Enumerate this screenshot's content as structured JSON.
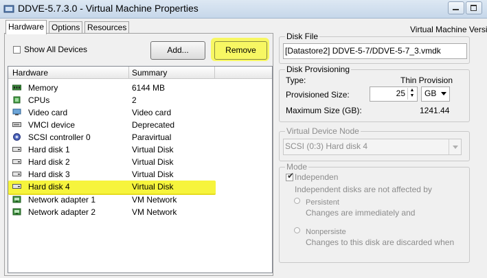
{
  "window": {
    "title": "DDVE-5.7.3.0 - Virtual Machine Properties",
    "right_header": "Virtual Machine Versi"
  },
  "tabs": [
    {
      "label": "Hardware",
      "active": true
    },
    {
      "label": "Options",
      "active": false
    },
    {
      "label": "Resources",
      "active": false
    }
  ],
  "toolbar": {
    "show_all_devices_label": "Show All Devices",
    "show_all_devices_checked": false,
    "add_label": "Add...",
    "remove_label": "Remove"
  },
  "hardware_table": {
    "columns": [
      "Hardware",
      "Summary"
    ],
    "rows": [
      {
        "name": "Memory",
        "summary": "6144 MB",
        "icon": "memory-icon"
      },
      {
        "name": "CPUs",
        "summary": "2",
        "icon": "cpu-icon"
      },
      {
        "name": "Video card",
        "summary": "Video card",
        "icon": "video-card-icon"
      },
      {
        "name": "VMCI device",
        "summary": "Deprecated",
        "icon": "vmci-device-icon"
      },
      {
        "name": "SCSI controller 0",
        "summary": "Paravirtual",
        "icon": "scsi-controller-icon"
      },
      {
        "name": "Hard disk 1",
        "summary": "Virtual Disk",
        "icon": "hard-disk-icon"
      },
      {
        "name": "Hard disk 2",
        "summary": "Virtual Disk",
        "icon": "hard-disk-icon"
      },
      {
        "name": "Hard disk 3",
        "summary": "Virtual Disk",
        "icon": "hard-disk-icon"
      },
      {
        "name": "Hard disk 4",
        "summary": "Virtual Disk",
        "icon": "hard-disk-icon",
        "selected": true
      },
      {
        "name": "Network adapter 1",
        "summary": "VM Network",
        "icon": "network-adapter-icon"
      },
      {
        "name": "Network adapter 2",
        "summary": "VM Network",
        "icon": "network-adapter-icon"
      }
    ]
  },
  "disk_file": {
    "group_label": "Disk File",
    "value": "[Datastore2] DDVE-5-7/DDVE-5-7_3.vmdk"
  },
  "disk_provisioning": {
    "group_label": "Disk Provisioning",
    "type_label": "Type:",
    "type_value": "Thin Provision",
    "provisioned_size_label": "Provisioned Size:",
    "provisioned_size_value": "25",
    "unit": "GB",
    "max_size_label": "Maximum Size (GB):",
    "max_size_value": "1241.44"
  },
  "virtual_device_node": {
    "group_label": "Virtual Device Node",
    "value": "SCSI (0:3) Hard disk 4"
  },
  "mode": {
    "group_label": "Mode",
    "independent_label": "Independen",
    "independent_checked": true,
    "independent_desc": "Independent disks are not affected by",
    "persistent_label": "Persistent",
    "persistent_desc": "Changes are immediately and",
    "nonpersistent_label": "Nonpersiste",
    "nonpersistent_desc": "Changes to this disk are discarded when"
  },
  "colors": {
    "highlight": "#f6f43c",
    "window_bg": "#f0f0f0",
    "titlebar": "#c6d7ea",
    "disabled_text": "#8c8c8c"
  }
}
